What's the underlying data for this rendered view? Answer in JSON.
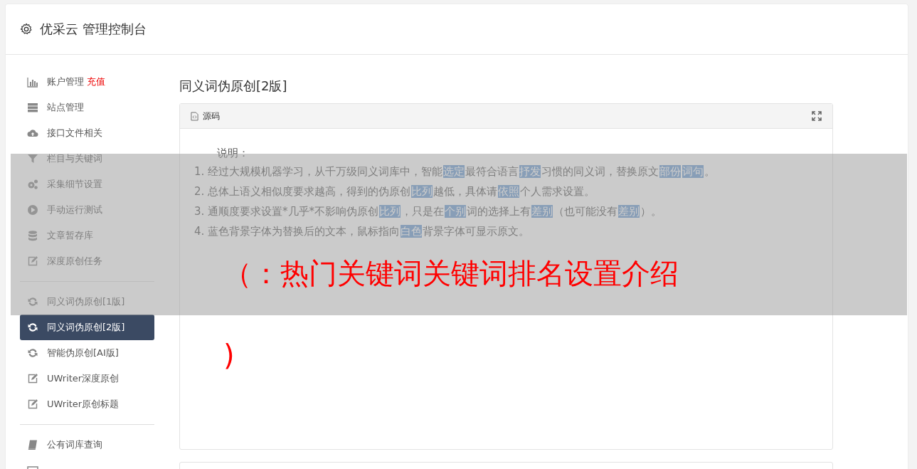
{
  "header": {
    "title": "优采云 管理控制台"
  },
  "sidebar": {
    "groups": [
      {
        "items": [
          {
            "label": "账户管理",
            "badge": "充值",
            "kind": "chart",
            "selected": false
          },
          {
            "label": "站点管理",
            "kind": "server",
            "selected": false
          },
          {
            "label": "接口文件相关",
            "kind": "cloud",
            "selected": false
          },
          {
            "label": "栏目与关键词",
            "kind": "filter",
            "selected": false
          },
          {
            "label": "采集细节设置",
            "kind": "gears",
            "selected": false
          },
          {
            "label": "手动运行测试",
            "kind": "play",
            "selected": false
          },
          {
            "label": "文章暂存库",
            "kind": "database",
            "selected": false
          },
          {
            "label": "深度原创任务",
            "kind": "edit",
            "selected": false
          }
        ]
      },
      {
        "items": [
          {
            "label": "同义词伪原创[1版]",
            "kind": "refresh",
            "selected": false
          },
          {
            "label": "同义词伪原创[2版]",
            "kind": "refresh",
            "selected": true
          },
          {
            "label": "智能伪原创[AI版]",
            "kind": "refresh",
            "selected": false
          },
          {
            "label": "UWriter深度原创",
            "kind": "edit",
            "selected": false
          },
          {
            "label": "UWriter原创标题",
            "kind": "edit",
            "selected": false
          }
        ]
      },
      {
        "items": [
          {
            "label": "公有词库查询",
            "kind": "book",
            "selected": false
          }
        ]
      }
    ]
  },
  "page_title": "同义词伪原创[2版]",
  "panel": {
    "tab": "源码",
    "heading": "说明：",
    "lines": [
      [
        {
          "text": "1. 经过大规模机器学习，从千万级同义词库中，智能",
          "highlighted": false
        },
        {
          "text": "选定",
          "highlighted": true
        },
        {
          "text": "最符合语言",
          "highlighted": false
        },
        {
          "text": "抒发",
          "highlighted": true
        },
        {
          "text": "习惯的同义词，替换原文",
          "highlighted": false
        },
        {
          "text": "部份",
          "highlighted": true
        },
        {
          "text": "词句",
          "highlighted": true
        },
        {
          "text": "。",
          "highlighted": false
        }
      ],
      [
        {
          "text": "2. 总体上语义相似度要求越高，得到的伪原创",
          "highlighted": false
        },
        {
          "text": "比列",
          "highlighted": true
        },
        {
          "text": "越低，具体请",
          "highlighted": false
        },
        {
          "text": "依照",
          "highlighted": true
        },
        {
          "text": "个人需求设置。",
          "highlighted": false
        }
      ],
      [
        {
          "text": "3. 通顺度要求设置*几乎*不影响伪原创",
          "highlighted": false
        },
        {
          "text": "比列",
          "highlighted": true
        },
        {
          "text": "，只是在",
          "highlighted": false
        },
        {
          "text": "个别",
          "highlighted": true
        },
        {
          "text": "词的选择上有",
          "highlighted": false
        },
        {
          "text": "差别",
          "highlighted": true
        },
        {
          "text": "（也可能没有",
          "highlighted": false
        },
        {
          "text": "差别",
          "highlighted": true
        },
        {
          "text": "）。",
          "highlighted": false
        }
      ],
      [
        {
          "text": "4. 蓝色背景字体为替换后的文本，鼠标指向",
          "highlighted": false
        },
        {
          "text": "白色",
          "highlighted": true
        },
        {
          "text": "背景字体可显示原文。",
          "highlighted": false
        }
      ]
    ]
  },
  "overlay": {
    "line_1": "（：热门关键词关键词排名设置介绍",
    "line_2": ")"
  }
}
